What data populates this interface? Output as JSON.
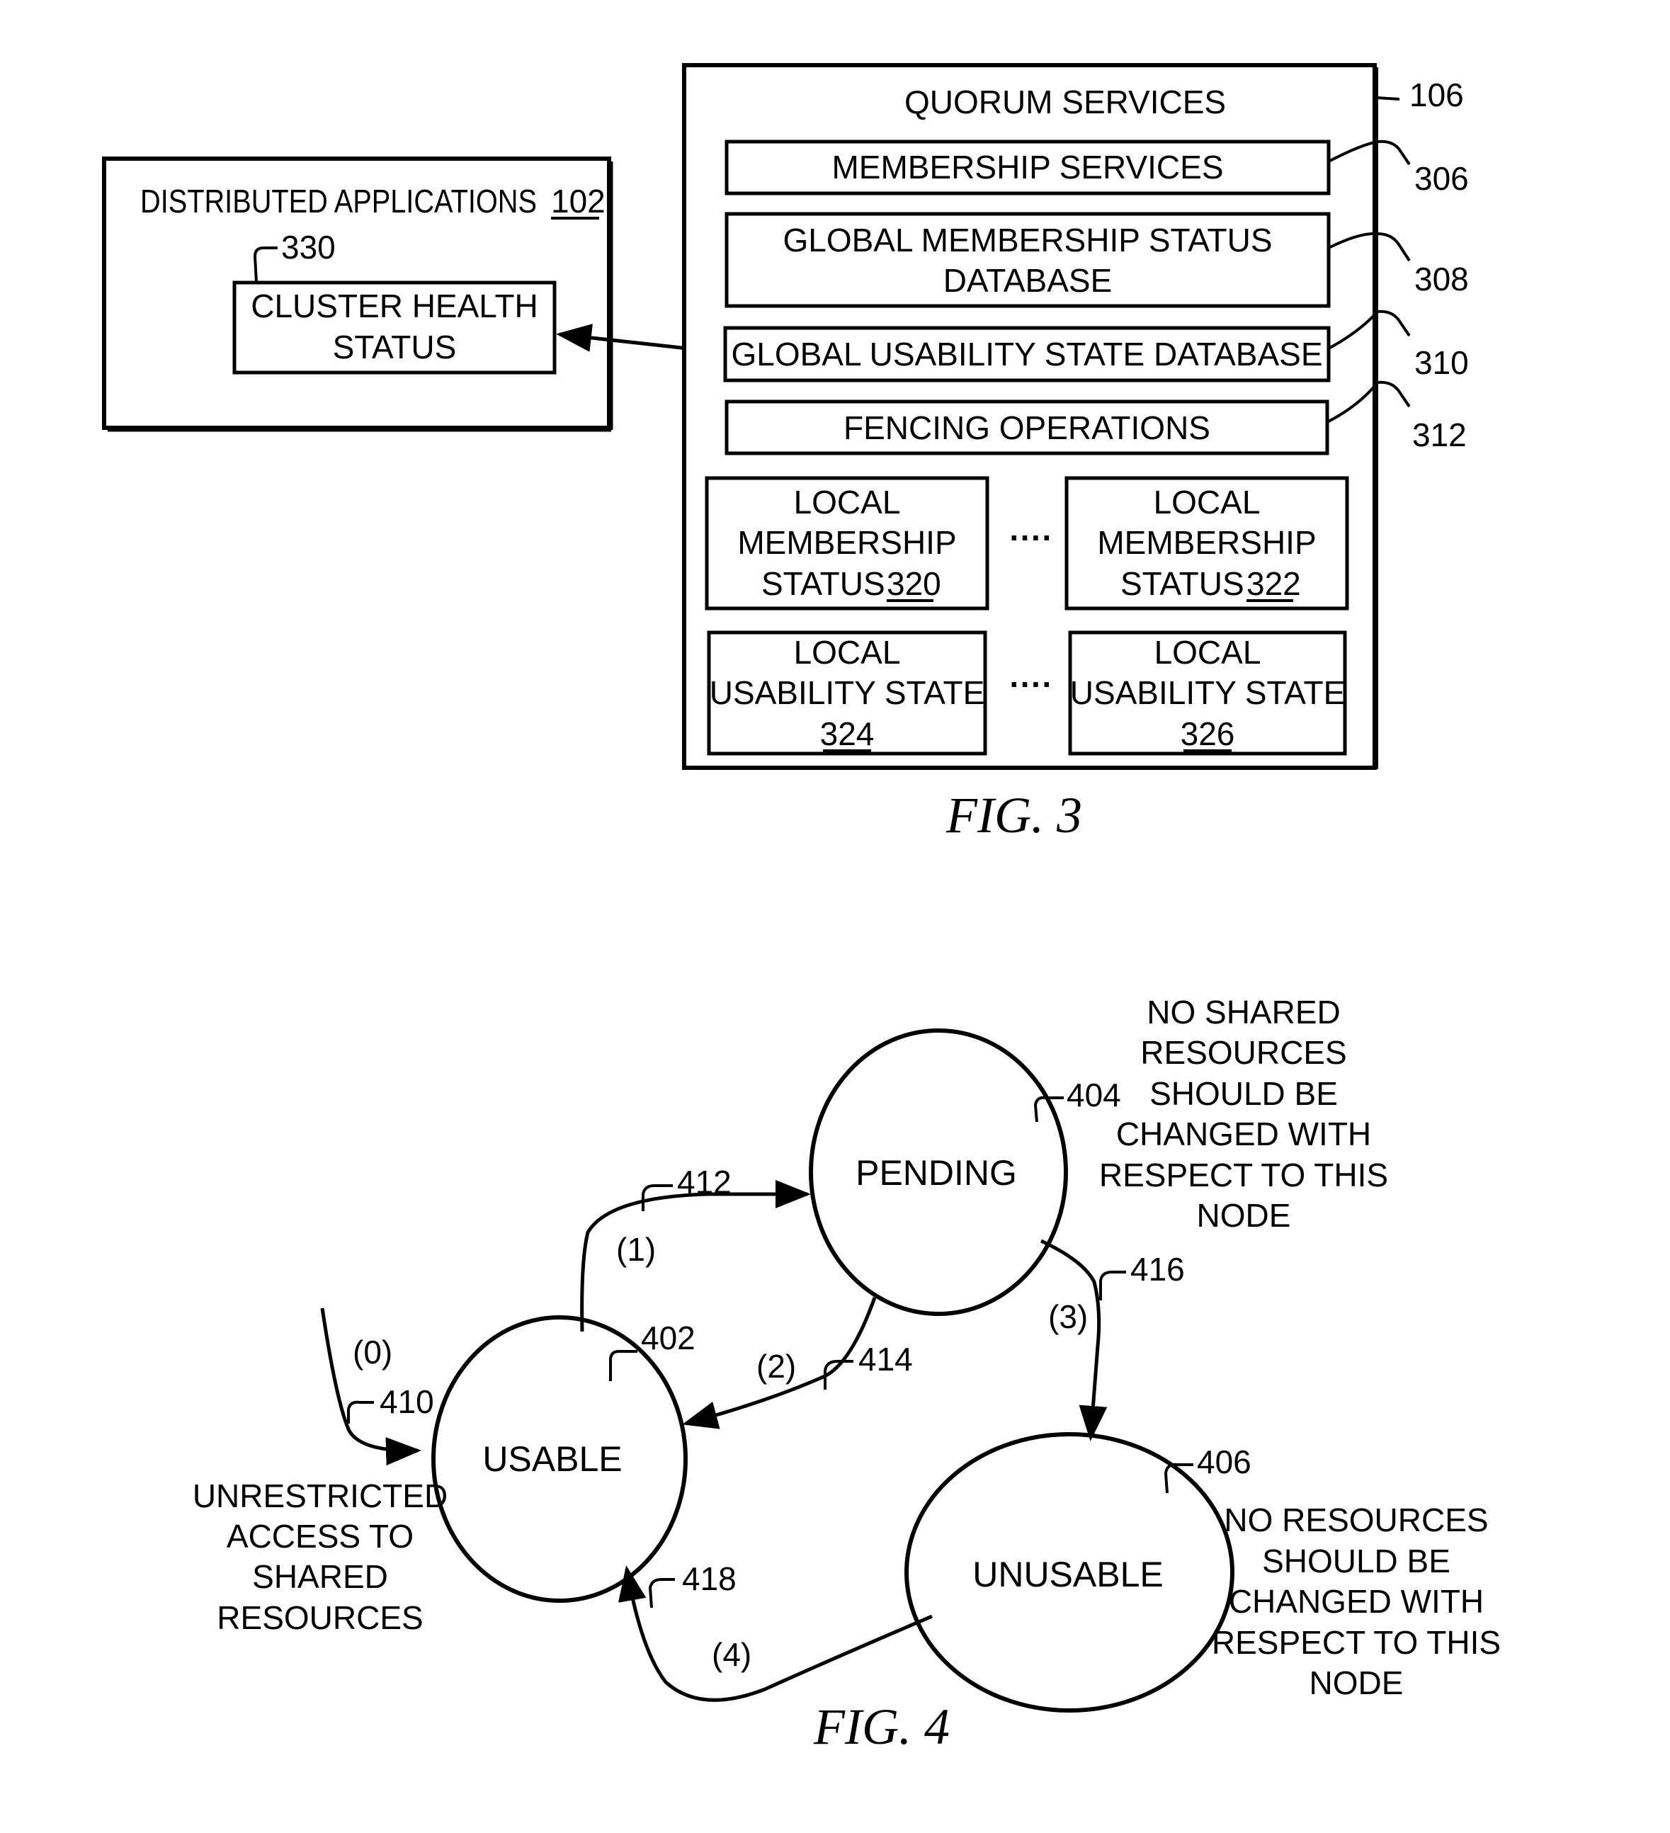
{
  "fig3": {
    "caption": "FIG. 3",
    "distributed_apps": {
      "title": "DISTRIBUTED APPLICATIONS",
      "ref": "102",
      "cluster_health": {
        "line1": "CLUSTER HEALTH",
        "line2": "STATUS",
        "ref": "330"
      }
    },
    "quorum": {
      "title": "QUORUM SERVICES",
      "ref": "106",
      "membership_services": {
        "label": "MEMBERSHIP SERVICES",
        "ref": "306"
      },
      "global_membership_db": {
        "line1": "GLOBAL MEMBERSHIP STATUS",
        "line2": "DATABASE",
        "ref": "308"
      },
      "global_usability_db": {
        "label": "GLOBAL USABILITY STATE DATABASE",
        "ref": "310"
      },
      "fencing": {
        "label": "FENCING OPERATIONS",
        "ref": "312"
      },
      "ellipsis": "····",
      "local_membership": [
        {
          "line1": "LOCAL",
          "line2": "MEMBERSHIP",
          "line3": "STATUS",
          "ref": "320"
        },
        {
          "line1": "LOCAL",
          "line2": "MEMBERSHIP",
          "line3": "STATUS",
          "ref": "322"
        }
      ],
      "local_usability": [
        {
          "line1": "LOCAL",
          "line2": "USABILITY STATE",
          "ref": "324"
        },
        {
          "line1": "LOCAL",
          "line2": "USABILITY STATE",
          "ref": "326"
        }
      ]
    }
  },
  "fig4": {
    "caption": "FIG. 4",
    "states": {
      "usable": {
        "label": "USABLE",
        "ref": "402"
      },
      "pending": {
        "label": "PENDING",
        "ref": "404"
      },
      "unusable": {
        "label": "UNUSABLE",
        "ref": "406"
      }
    },
    "transitions": [
      {
        "label": "(0)",
        "ref": "410"
      },
      {
        "label": "(1)",
        "ref": "412"
      },
      {
        "label": "(2)",
        "ref": "414"
      },
      {
        "label": "(3)",
        "ref": "416"
      },
      {
        "label": "(4)",
        "ref": "418"
      }
    ],
    "notes": {
      "usable": [
        "UNRESTRICTED",
        "ACCESS TO",
        "SHARED",
        "RESOURCES"
      ],
      "pending": [
        "NO SHARED",
        "RESOURCES",
        "SHOULD BE",
        "CHANGED WITH",
        "RESPECT TO THIS",
        "NODE"
      ],
      "unusable": [
        "NO RESOURCES",
        "SHOULD BE",
        "CHANGED WITH",
        "RESPECT TO THIS",
        "NODE"
      ]
    }
  }
}
